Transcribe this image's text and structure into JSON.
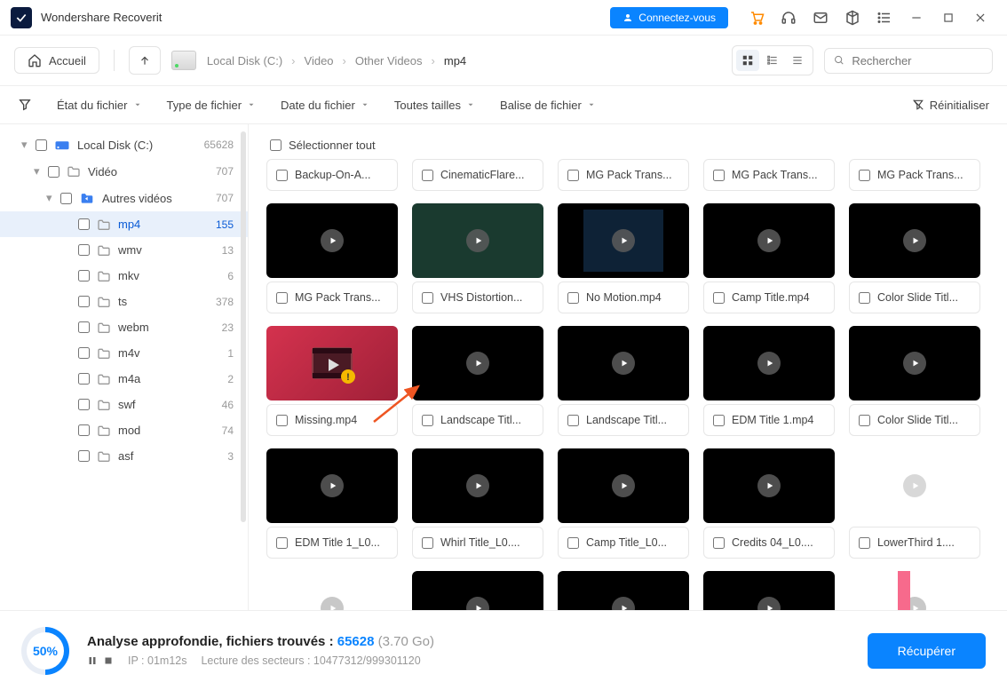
{
  "titlebar": {
    "app_name": "Wondershare Recoverit",
    "connect_label": "Connectez-vous"
  },
  "toolbar": {
    "home_label": "Accueil",
    "breadcrumb": [
      "Local Disk (C:)",
      "Video",
      "Other Videos",
      "mp4"
    ],
    "search_placeholder": "Rechercher"
  },
  "filters": {
    "file_status": "État du fichier",
    "file_type": "Type de fichier",
    "file_date": "Date du fichier",
    "file_size": "Toutes tailles",
    "file_tag": "Balise de fichier",
    "reset": "Réinitialiser"
  },
  "sidebar": [
    {
      "label": "Local Disk (C:)",
      "count": "65628",
      "level": 0,
      "caret": "▾",
      "icon": "drive"
    },
    {
      "label": "Vidéo",
      "count": "707",
      "level": 1,
      "caret": "▾",
      "icon": "folder"
    },
    {
      "label": "Autres vidéos",
      "count": "707",
      "level": 2,
      "caret": "▾",
      "icon": "folder-blue"
    },
    {
      "label": "mp4",
      "count": "155",
      "level": 3,
      "selected": true,
      "icon": "folder"
    },
    {
      "label": "wmv",
      "count": "13",
      "level": 3,
      "icon": "folder"
    },
    {
      "label": "mkv",
      "count": "6",
      "level": 3,
      "icon": "folder"
    },
    {
      "label": "ts",
      "count": "378",
      "level": 3,
      "icon": "folder"
    },
    {
      "label": "webm",
      "count": "23",
      "level": 3,
      "icon": "folder"
    },
    {
      "label": "m4v",
      "count": "1",
      "level": 3,
      "icon": "folder"
    },
    {
      "label": "m4a",
      "count": "2",
      "level": 3,
      "icon": "folder"
    },
    {
      "label": "swf",
      "count": "46",
      "level": 3,
      "icon": "folder"
    },
    {
      "label": "mod",
      "count": "74",
      "level": 3,
      "icon": "folder"
    },
    {
      "label": "asf",
      "count": "3",
      "level": 3,
      "icon": "folder"
    }
  ],
  "grid": {
    "select_all": "Sélectionner tout",
    "row0": [
      "Backup-On-A...",
      "CinematicFlare...",
      "MG Pack Trans...",
      "MG Pack Trans...",
      "MG Pack Trans..."
    ],
    "row1": [
      {
        "name": "MG Pack Trans...",
        "bg": "#000"
      },
      {
        "name": "VHS Distortion...",
        "bg": "#1a3a2f"
      },
      {
        "name": "No Motion.mp4",
        "bg": "#0b1826",
        "inset": true
      },
      {
        "name": "Camp Title.mp4",
        "bg": "#000"
      },
      {
        "name": "Color Slide Titl...",
        "bg": "#000"
      }
    ],
    "row2": [
      {
        "name": "Missing.mp4",
        "bg": "#c0233b",
        "missing": true
      },
      {
        "name": "Landscape Titl...",
        "bg": "#000"
      },
      {
        "name": "Landscape Titl...",
        "bg": "#000"
      },
      {
        "name": "EDM Title 1.mp4",
        "bg": "#000"
      },
      {
        "name": "Color Slide Titl...",
        "bg": "#000"
      }
    ],
    "row3": [
      {
        "name": "EDM Title 1_L0...",
        "bg": "#000"
      },
      {
        "name": "Whirl Title_L0....",
        "bg": "#000"
      },
      {
        "name": "Camp Title_L0...",
        "bg": "#000"
      },
      {
        "name": "Credits 04_L0....",
        "bg": "#000"
      },
      {
        "name": "LowerThird 1....",
        "bg": "#fff",
        "light": true
      }
    ],
    "row4": [
      {
        "bg": "#fff",
        "accent": "#5fd4c8"
      },
      {
        "bg": "#000"
      },
      {
        "bg": "#000"
      },
      {
        "bg": "#000",
        "accent": "#000",
        "stripe": "#000"
      },
      {
        "bg": "#fff",
        "accent": "#f76a8c"
      }
    ]
  },
  "footer": {
    "percent": "50%",
    "line1_prefix": "Analyse approfondie, fichiers trouvés : ",
    "line1_count": "65628",
    "line1_size": "(3.70 Go)",
    "ip_label": "IP : 01m12s",
    "sector_label": "Lecture des secteurs : 10477312/999301120",
    "recover": "Récupérer"
  }
}
